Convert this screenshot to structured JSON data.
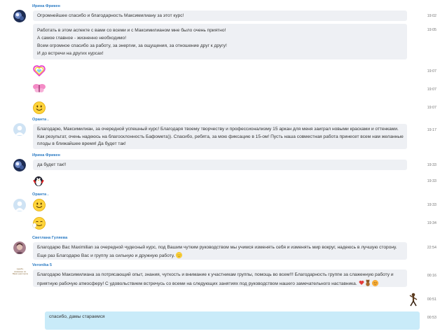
{
  "messages": [
    {
      "sender": "Ирина Фрикен",
      "lines": [
        "Огромнейшее спасибо и благодарность Максимилиану за этот курс!"
      ],
      "time": "19:02"
    },
    {
      "lines": [
        "Работать в этом аспекте с вами со всеми и с Максимилианом мне было очень приятно!",
        "А самое главное - жизненно необходимо!",
        "Всем огромное спасибо за работу, за энергии, за ощущения, за отношение друг к другу!",
        "И до встречи на других курсах!"
      ],
      "time": "19:05"
    },
    {
      "emoji": "rainbow-heart-emoticon",
      "time": "19:07"
    },
    {
      "emoji": "pink-butterfly-emoticon",
      "time": "19:07"
    },
    {
      "emoji": "smile-emoticon",
      "time": "19:07"
    },
    {
      "sender": "Оранта .",
      "lines": [
        "Благодарю, Максимилиан, за очередной успешный курс! Благодаря твоему творчеству и профессионализму 15 аркан для меня заиграл новыми красками и оттенками.",
        "Как результат, очень надеюсь на благосклонность Бафомета)). Спасибо, ребята, за мою фиксацию в 15-ом! Пусть наша совместная работа принесет всем нам желанные",
        "плоды в ближайшее время! Да будет так!"
      ],
      "time": "19:17"
    },
    {
      "sender": "Ирина Фрикен",
      "lines": [
        "да будет так!!"
      ],
      "time": "19:33"
    },
    {
      "emoji": "penguin-emoticon",
      "time": "19:33"
    },
    {
      "sender": "Оранта .",
      "emoji": "smile-emoticon",
      "time": "19:33"
    },
    {
      "emoji": "dreamy-smile-emoticon",
      "time": "19:34"
    },
    {
      "sender": "Светлана Гуляева",
      "lines": [
        "Благодарю Вас Maximilian за очередной чудесный курс, под Вашим чутким руководством мы учимся изменять себя и изменять мир вокруг, надеюсь в лучшую сторону.",
        "Еще раз Благодарю Вас и группу за сильную и дружную работу."
      ],
      "time": "22:54"
    },
    {
      "sender": "Veronika 5",
      "lines": [
        "Благодарю Максимилиана за потрясающий  опыт, знания, чуткость и внимание к участникам группы, помощь во всем!!!  Благодарность группе за слаженную работу и",
        "приятную рабочую атмосферу! С удовольствием встречусь со всеми на следующих занятиях под руководством нашего замечательного наставника."
      ],
      "time": "00:16"
    },
    {
      "emoji": "dancer-emoticon",
      "time": "00:51"
    },
    {
      "mine": true,
      "lines": [
        "спасибо, дамы",
        "стараемся"
      ],
      "time": "00:53"
    }
  ],
  "veronika_avatar_text": "судьба - возможно ли. Ваши руки прочн"
}
